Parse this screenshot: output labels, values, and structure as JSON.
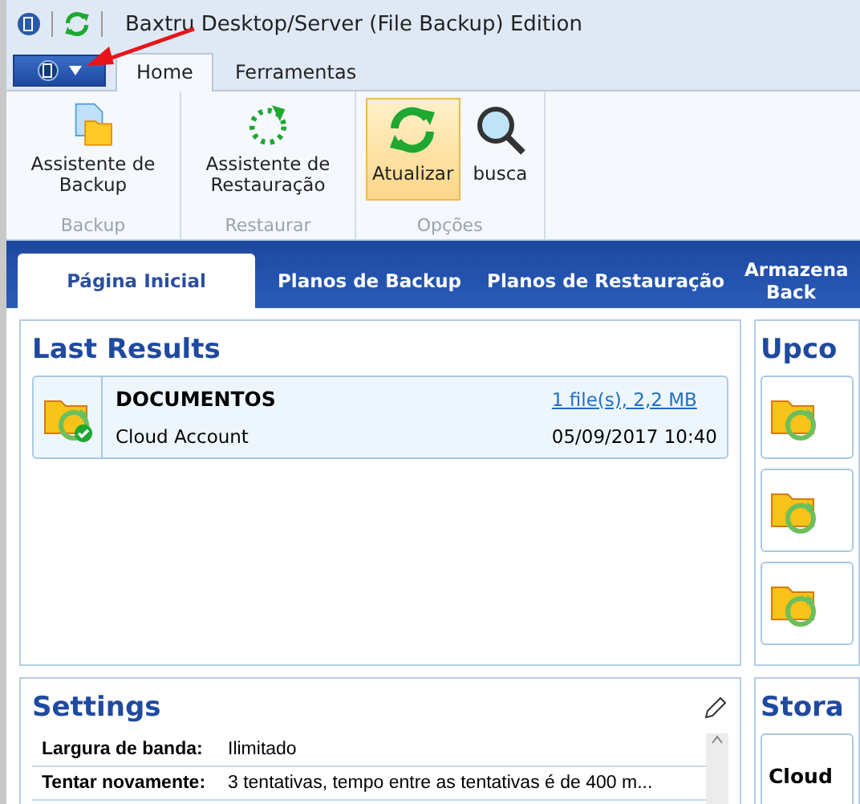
{
  "window": {
    "title": "Baxtru Desktop/Server (File Backup) Edition"
  },
  "ribbon_tabs": [
    {
      "label": "Home",
      "selected": true
    },
    {
      "label": "Ferramentas",
      "selected": false
    }
  ],
  "ribbon_groups": [
    {
      "label": "Backup",
      "buttons": [
        {
          "label": "Assistente de Backup",
          "kind": "backup",
          "selected": false
        }
      ]
    },
    {
      "label": "Restaurar",
      "buttons": [
        {
          "label": "Assistente de Restauração",
          "kind": "restore",
          "selected": false
        }
      ]
    },
    {
      "label": "Opções",
      "buttons": [
        {
          "label": "Atualizar",
          "kind": "refresh",
          "selected": true
        },
        {
          "label": "busca",
          "kind": "search",
          "selected": false
        }
      ]
    }
  ],
  "main_tabs": [
    {
      "label": "Página Inicial",
      "selected": true
    },
    {
      "label": "Planos de Backup",
      "selected": false
    },
    {
      "label": "Planos de Restauração",
      "selected": false
    },
    {
      "label": "Armazena",
      "label_line_2": "Back",
      "selected": false
    }
  ],
  "last_results": {
    "title": "Last Results",
    "items": [
      {
        "name": "DOCUMENTOS",
        "account": "Cloud Account",
        "size": "1 file(s), 2,2 MB",
        "date": "05/09/2017 10:40"
      }
    ]
  },
  "upcoming": {
    "title": "Upco",
    "items": [
      {
        "kind": "plan"
      },
      {
        "kind": "plan"
      },
      {
        "kind": "plan"
      }
    ]
  },
  "settings": {
    "title": "Settings",
    "rows": [
      {
        "label": "Largura de banda:",
        "value": "Ilimitado"
      },
      {
        "label": "Tentar novamente:",
        "value": "3  tentativas, tempo entre as tentativas é de 400 m..."
      }
    ]
  },
  "storage": {
    "title": "Stora",
    "items": [
      {
        "name": "Cloud"
      }
    ]
  }
}
